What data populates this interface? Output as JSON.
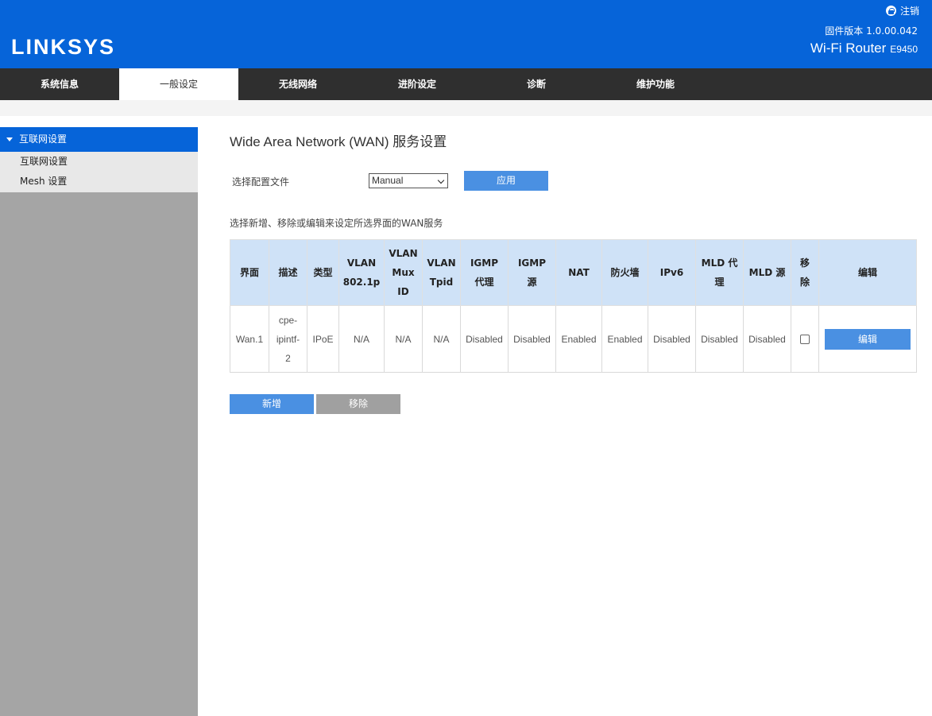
{
  "header": {
    "logo": "LINKSYS",
    "logout_label": "注销",
    "firmware": "固件版本 1.0.00.042",
    "product": "Wi-Fi Router",
    "model": "E9450",
    "brand_color": "#0664d9"
  },
  "nav": {
    "items": [
      {
        "label": "系统信息"
      },
      {
        "label": "一般设定"
      },
      {
        "label": "无线网络"
      },
      {
        "label": "进阶设定"
      },
      {
        "label": "诊断"
      },
      {
        "label": "维护功能"
      }
    ],
    "active_index": 1
  },
  "sidebar": {
    "section": "互联网设置",
    "items": [
      {
        "label": "互联网设置"
      },
      {
        "label": "Mesh 设置"
      }
    ]
  },
  "main": {
    "title": "Wide Area Network (WAN) 服务设置",
    "profile_label": "选择配置文件",
    "profile_value": "Manual",
    "apply_label": "应用",
    "instruction": "选择新增、移除或编辑来设定所选界面的WAN服务",
    "table": {
      "headers": [
        [
          "界面"
        ],
        [
          "描述"
        ],
        [
          "类型"
        ],
        [
          "VLAN",
          "802.1p"
        ],
        [
          "VLAN",
          "Mux",
          "ID"
        ],
        [
          "VLAN",
          "Tpid"
        ],
        [
          "IGMP",
          "代理"
        ],
        [
          "IGMP",
          "源"
        ],
        [
          "NAT"
        ],
        [
          "防火墙"
        ],
        [
          "IPv6"
        ],
        [
          "MLD 代",
          "理"
        ],
        [
          "MLD 源"
        ],
        [
          "移",
          "除"
        ],
        [
          "编辑"
        ]
      ],
      "rows": [
        {
          "interface": "Wan.1",
          "desc": [
            "cpe-",
            "ipintf-",
            "2"
          ],
          "type": "IPoE",
          "vlan_8021p": "N/A",
          "vlan_mux_id": "N/A",
          "vlan_tpid": "N/A",
          "igmp_proxy": "Disabled",
          "igmp_source": "Disabled",
          "nat": "Enabled",
          "firewall": "Enabled",
          "ipv6": "Disabled",
          "mld_proxy": "Disabled",
          "mld_source": "Disabled",
          "remove_checked": false,
          "edit_label": "编辑"
        }
      ]
    },
    "add_label": "新增",
    "remove_label": "移除"
  }
}
